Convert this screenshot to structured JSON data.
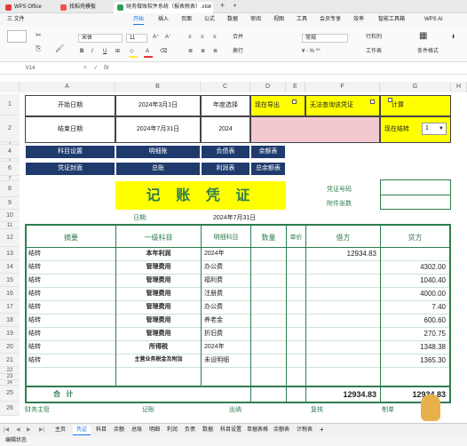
{
  "titlebar": {
    "tabs": [
      "WPS Office",
      "找稻壳模板",
      "财务做账软件系统（报表税表）.xlsx"
    ]
  },
  "menu": {
    "items": [
      "三 文件",
      "开始",
      "插入",
      "页面",
      "公式",
      "数据",
      "审阅",
      "视图",
      "工具",
      "会员专享",
      "效率",
      "智能工具箱",
      "WPS AI"
    ],
    "active": "开始"
  },
  "toolbar": {
    "font_name": "宋体",
    "font_size": "11",
    "bold": "B",
    "italic": "I",
    "underline": "U",
    "font_color_label": "A",
    "merge": "合并",
    "wrap": "换行",
    "format": "常规",
    "row_col": "行和列",
    "worksheet": "工作表",
    "cond_format": "条件格式",
    "colors": {
      "accent": "#1a73e8",
      "font_color_bar": "#e53935",
      "fill_bar": "#ffeb3b"
    }
  },
  "formula_bar": {
    "cell_ref": "V14",
    "fx": "fx",
    "value": ""
  },
  "sheet": {
    "col_headers": [
      "A",
      "B",
      "C",
      "D",
      "E",
      "F",
      "G",
      "H"
    ],
    "row_headers": [
      "1",
      "2",
      "3",
      "4",
      "5",
      "6",
      "7",
      "8",
      "9",
      "10",
      "11",
      "12",
      "13",
      "14",
      "15",
      "16",
      "17",
      "18",
      "19",
      "20",
      "21",
      "22",
      "23",
      "24",
      "25",
      "26"
    ],
    "start_date_label": "开始日期",
    "start_date_value": "2024年3月1日",
    "year_select_label": "年度选择",
    "end_date_label": "结束日期",
    "end_date_value": "2024年7月31日",
    "year_value": "2024",
    "btn_export": "现在导出",
    "btn_no_query": "无法查询该凭证",
    "btn_calc": "计算",
    "cur_month_label": "现在结转",
    "cur_month_value": "1",
    "nav": {
      "subject_settings": "科目设置",
      "detail_ledger": "明细账",
      "liabilities": "负债表",
      "balance_table": "余额表",
      "voucher_cover": "凭证封面",
      "general_ledger": "总账",
      "income_statement": "利润表",
      "total_balance": "总余额表"
    },
    "voucher_title": "记 账 凭 证",
    "voucher_no_label": "凭证号码",
    "attach_label": "附件张数",
    "date_label": "日期:",
    "date_value": "2024年7月31日",
    "table_headers": [
      "摘要",
      "一级科目",
      "明细科目",
      "数量",
      "单价",
      "借方",
      "贷方"
    ],
    "rows": [
      {
        "summary": "结转",
        "subject": "本年利润",
        "detail": "2024年",
        "debit": "12934.83",
        "credit": ""
      },
      {
        "summary": "结转",
        "subject": "管理费用",
        "detail": "办公费",
        "debit": "",
        "credit": "4302.00"
      },
      {
        "summary": "结转",
        "subject": "管理费用",
        "detail": "福利费",
        "debit": "",
        "credit": "1040.40"
      },
      {
        "summary": "结转",
        "subject": "管理费用",
        "detail": "注册费",
        "debit": "",
        "credit": "4000.00"
      },
      {
        "summary": "结转",
        "subject": "管理费用",
        "detail": "办公费",
        "debit": "",
        "credit": "7.40"
      },
      {
        "summary": "结转",
        "subject": "管理费用",
        "detail": "养老金",
        "debit": "",
        "credit": "600.60"
      },
      {
        "summary": "结转",
        "subject": "管理费用",
        "detail": "折旧费",
        "debit": "",
        "credit": "270.75"
      },
      {
        "summary": "结转",
        "subject": "所得税",
        "detail": "2024年",
        "debit": "",
        "credit": "1348.38"
      },
      {
        "summary": "结转",
        "subject": "主营业务税金及附加",
        "detail": "未设明细",
        "debit": "",
        "credit": "1365.30"
      }
    ],
    "total_label": "合  计",
    "total_debit": "12934.83",
    "total_credit": "12934.83",
    "footer": {
      "finance_head": "财务主管",
      "bookkeeping": "记账",
      "cashier": "出纳",
      "review": "复核",
      "maker": "制单"
    }
  },
  "sheet_tabs": {
    "items": [
      "主页",
      "凭证",
      "科目",
      "余额",
      "总账",
      "明细",
      "利润",
      "负债",
      "数据",
      "科目设置",
      "单据表格",
      "余额表",
      "计税表"
    ],
    "active": "凭证"
  },
  "status": {
    "text": "编辑状态"
  }
}
